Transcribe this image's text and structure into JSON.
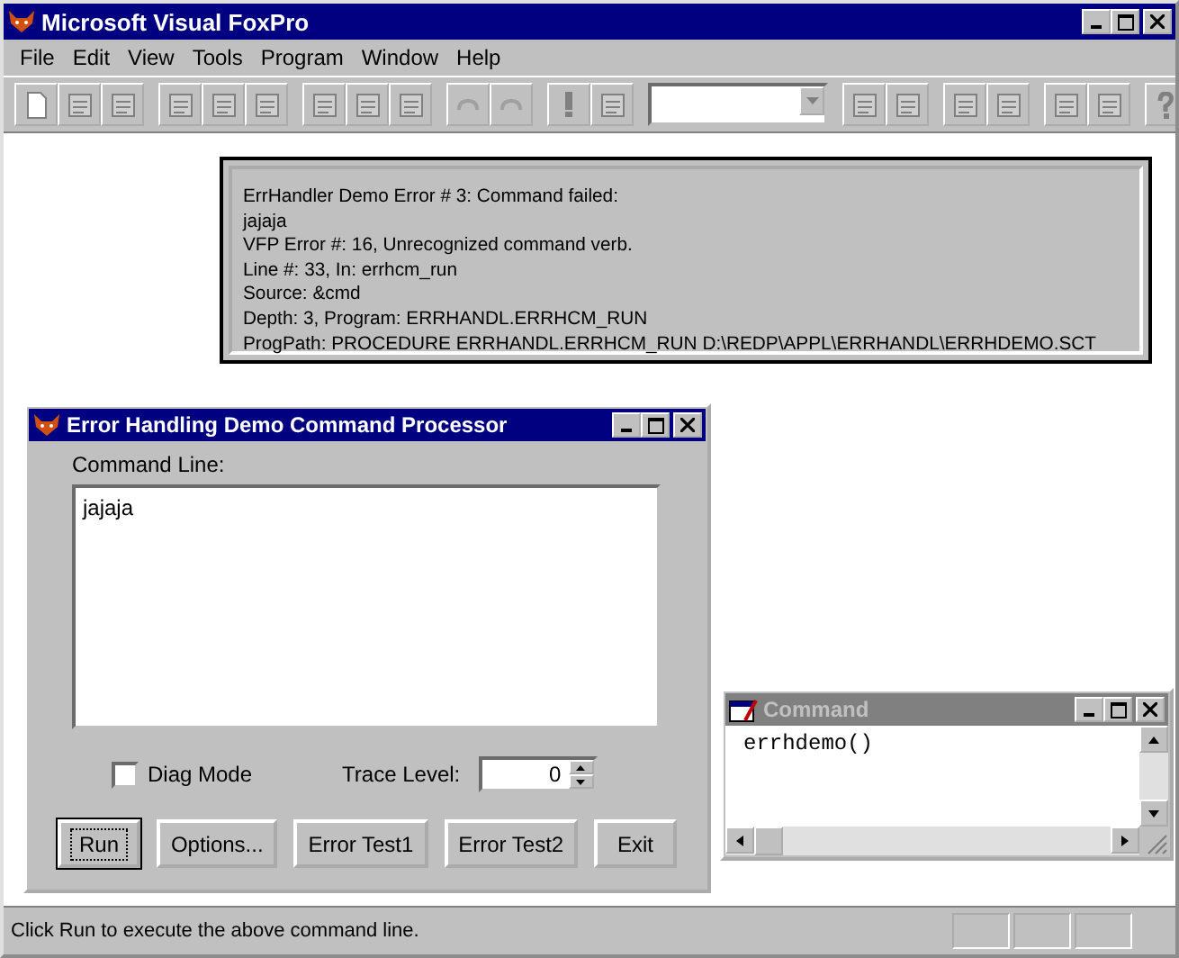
{
  "window": {
    "title": "Microsoft Visual FoxPro",
    "active": true
  },
  "menu": [
    "File",
    "Edit",
    "View",
    "Tools",
    "Program",
    "Window",
    "Help"
  ],
  "error_message": {
    "lines": [
      "ErrHandler Demo Error # 3: Command failed:",
      "jajaja",
      "VFP Error #: 16, Unrecognized command verb.",
      "Line #: 33, In: errhcm_run",
      "Source: &cmd",
      "Depth: 3, Program: ERRHANDL.ERRHCM_RUN",
      "ProgPath: PROCEDURE ERRHANDL.ERRHCM_RUN D:\\REDP\\APPL\\ERRHANDL\\ERRHDEMO.SCT"
    ]
  },
  "form": {
    "title": "Error Handling Demo Command Processor",
    "active": true,
    "command_label": "Command Line:",
    "command_text": "jajaja",
    "diag_mode": {
      "label": "Diag Mode",
      "checked": false
    },
    "trace_level": {
      "label": "Trace Level:",
      "value": "0"
    },
    "buttons": [
      {
        "label": "Run",
        "focused": true
      },
      {
        "label": "Options...",
        "focused": false
      },
      {
        "label": "Error Test1",
        "focused": false
      },
      {
        "label": "Error Test2",
        "focused": false
      },
      {
        "label": "Exit",
        "focused": false
      }
    ]
  },
  "command_window": {
    "title": "Command",
    "active": false,
    "text": "errhdemo()"
  },
  "status_bar": {
    "text": "Click Run to execute the above command line."
  }
}
